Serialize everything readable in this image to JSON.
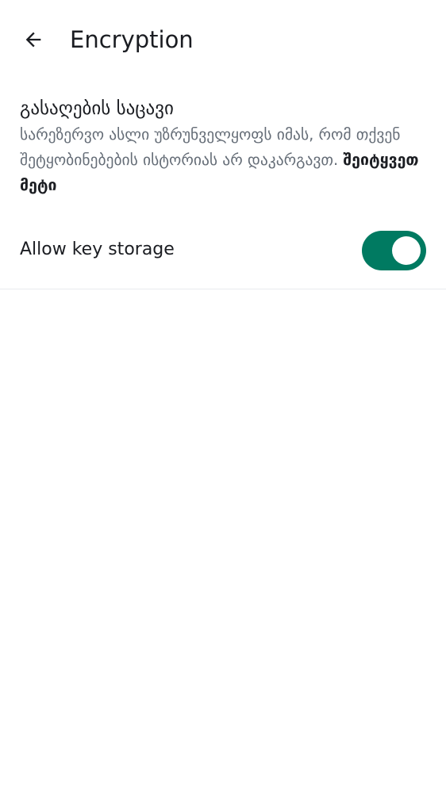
{
  "header": {
    "back_icon": "arrow-left-icon",
    "title": "Encryption"
  },
  "backup_section": {
    "title": "გასაღების საცავი",
    "description": "სარეზერვო ასლი უზრუნველყოფს იმას, რომ თქვენ შეტყობინებების ისტორიას არ დაკარგავთ.",
    "learn_more": "შეიტყვეთ მეტი"
  },
  "key_storage": {
    "label": "Allow key storage",
    "enabled": true,
    "accent_color": "#007a61"
  }
}
